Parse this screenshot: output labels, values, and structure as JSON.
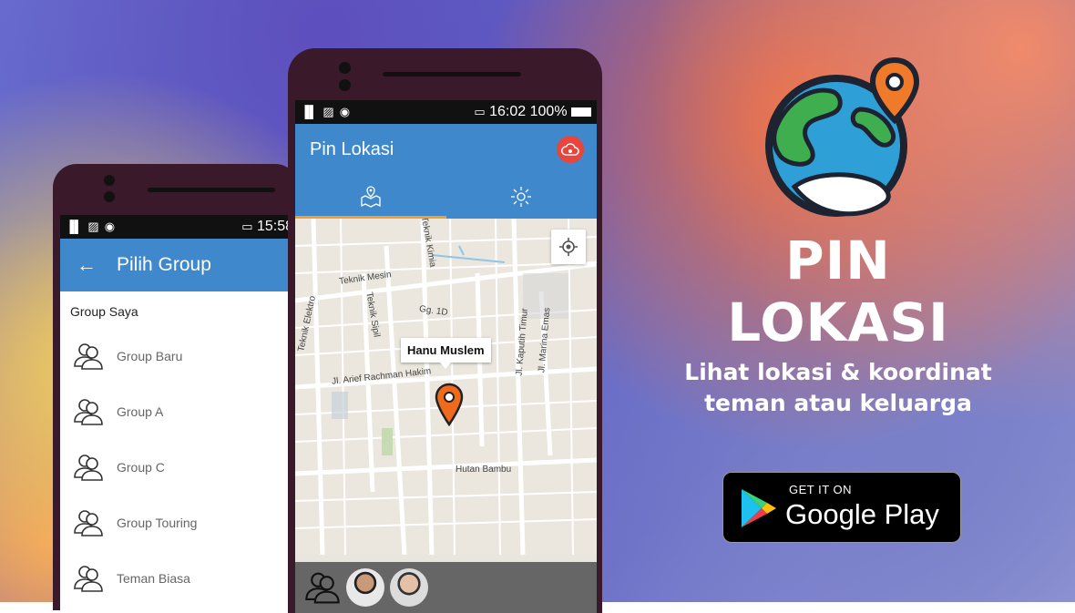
{
  "back_phone": {
    "status_time": "15:58",
    "status_icons": "signal-gallery-wifi",
    "appbar_title": "Pilih Group",
    "section_header": "Group Saya",
    "groups": [
      {
        "label": "Group Baru"
      },
      {
        "label": "Group A"
      },
      {
        "label": "Group C"
      },
      {
        "label": "Group Touring"
      },
      {
        "label": "Teman Biasa"
      }
    ]
  },
  "front_phone": {
    "status_time": "16:02",
    "status_battery": "100%",
    "appbar_title": "Pin Lokasi",
    "tabs": [
      {
        "icon": "map-pin-icon",
        "active": true
      },
      {
        "icon": "settings-gear-icon",
        "active": false
      }
    ],
    "map": {
      "pin_label": "Hanu Muslem",
      "streets": [
        "Teknik Mesin",
        "Teknik Kimia",
        "Teknik Elektro",
        "Teknik Sipil",
        "Gg. 1D",
        "Jl. Arief Rachman Hakim",
        "Jl. Kaputih Timur",
        "Jl. Marina Emas",
        "Hutan Bambu"
      ]
    },
    "bottom_bar": {
      "avatars": [
        "avatar-1",
        "avatar-2"
      ]
    }
  },
  "brand": {
    "title": "PIN LOKASI",
    "tagline_line1": "Lihat lokasi & koordinat",
    "tagline_line2": "teman atau keluarga",
    "play_button": {
      "small": "GET IT ON",
      "large": "Google Play"
    }
  },
  "colors": {
    "appbar": "#3f88cc",
    "tab_indicator": "#f0a030",
    "pin": "#ef6a1c",
    "phone_body": "#3a1a2a"
  }
}
